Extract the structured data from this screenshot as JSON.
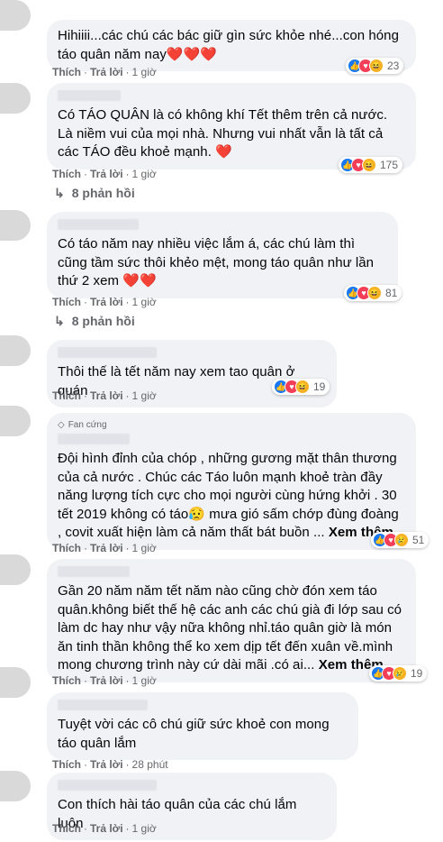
{
  "ui": {
    "like_label": "Thích",
    "reply_label": "Trả lời",
    "see_more_label": "Xem thêm",
    "fan_badge_label": "Fan cứng"
  },
  "comments": [
    {
      "text": "Hihiiii...các chú các bác giữ gìn sức khỏe nhé...con hóng táo quân năm nay❤️❤️❤️",
      "time": "1 giờ",
      "reactions": "23"
    },
    {
      "text": "Có TÁO QUÂN là có không khí Tết thêm trên cả nước. Là niềm vui của mọi nhà. Nhưng vui nhất vẫn là tất cả các TÁO đều khoẻ mạnh. ❤️",
      "time": "1 giờ",
      "reactions": "175",
      "replies": "8 phản hồi"
    },
    {
      "text": "Có táo năm nay nhiều việc lắm á, các chú làm thì cũng tầm sức thôi khẻo mệt, mong táo quân như lần thứ 2 xem ❤️❤️",
      "time": "1 giờ",
      "reactions": "81",
      "replies": "8 phản hồi"
    },
    {
      "text": "Thôi thế là tết năm nay xem tao quân ở quán",
      "time": "1 giờ",
      "reactions": "19"
    },
    {
      "text": "Đội hình đỉnh của chóp , những gương mặt thân thương của cả nước . Chúc các Táo luôn mạnh khoẻ tràn đầy năng lượng tích cực cho mọi người cùng hứng khởi . 30 tết 2019 không có táo😥 mưa gió sấm chớp đùng đoàng , covit xuất hiện làm cả năm thất bát buồn ...",
      "time": "1 giờ",
      "reactions": "51"
    },
    {
      "text": "Gần 20 năm năm tết năm nào cũng chờ đón xem táo quân.không biết thế hệ các anh các chú già đi lớp sau có làm dc hay như vậy nữa không nhỉ.táo quân giờ là món ăn tinh thần không thể ko xem dịp tết đến xuân về.mình mong chương trình này cứ dài mãi .có ai...",
      "time": "1 giờ",
      "reactions": "19"
    },
    {
      "text": "Tuyệt vời các cô chú giữ sức khoẻ con mong táo quân lắm",
      "time": "28 phút"
    },
    {
      "text": "Con thích hài táo quân của các chú lắm luôn",
      "time": "1 giờ"
    }
  ]
}
